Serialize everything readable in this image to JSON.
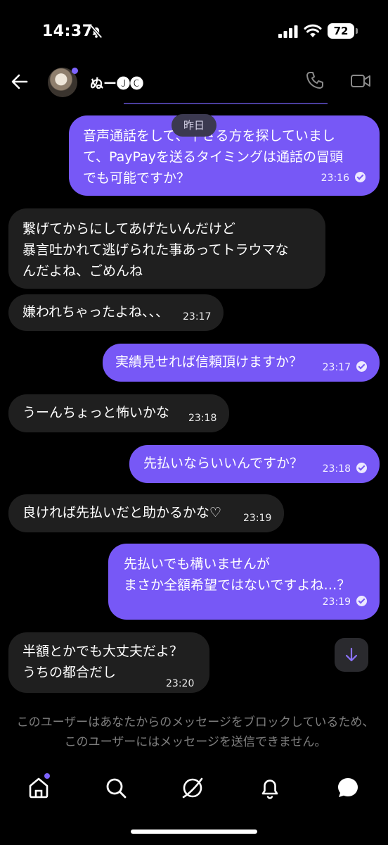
{
  "status_bar": {
    "time": "14:37",
    "battery": "72"
  },
  "header": {
    "contact_name": "ぬー🅙🅒"
  },
  "date_divider": "昨日",
  "messages": [
    {
      "dir": "out",
      "text": "音声通話をして、下さる方を探していまして、PayPayを送るタイミングは通話の冒頭でも可能ですか？",
      "lines": "音声通話をして、下さる方を探していまし\nて、PayPayを送るタイミングは通話の冒頭\nでも可能ですか？",
      "time": "23:16",
      "read": true
    },
    {
      "dir": "in",
      "text": "繋げてからにしてあげたいんだけど暴言吐かれて逃げられた事あってトラウマなんだよね、ごめんね",
      "lines": "繋げてからにしてあげたいんだけど\n暴言吐かれて逃げられた事あってトラウマな\nんだよね、ごめんね",
      "time": ""
    },
    {
      "dir": "in",
      "text": "嫌われちゃったよね、、、",
      "lines": "嫌われちゃったよね、、、",
      "time": "23:17"
    },
    {
      "dir": "out",
      "text": "実績見せれば信頼頂けますか？",
      "lines": "実績見せれば信頼頂けますか？",
      "time": "23:17",
      "read": true
    },
    {
      "dir": "in",
      "text": "うーんちょっと怖いかな",
      "lines": "うーんちょっと怖いかな",
      "time": "23:18"
    },
    {
      "dir": "out",
      "text": "先払いならいいんですか？",
      "lines": "先払いならいいんですか？",
      "time": "23:18",
      "read": true
    },
    {
      "dir": "in",
      "text": "良ければ先払いだと助かるかな♡",
      "lines": "良ければ先払いだと助かるかな♡",
      "time": "23:19"
    },
    {
      "dir": "out",
      "text": "先払いでも構いませんがまさか全額希望ではないですよね…？",
      "lines": "先払いでも構いませんが\nまさか全額希望ではないですよね…？",
      "time": "23:19",
      "read": true
    },
    {
      "dir": "in",
      "text": "半額とかでも大丈夫だよ？うちの都合だし",
      "lines": "半額とかでも大丈夫だよ？\nうちの都合だし",
      "time": "23:20"
    }
  ],
  "blocked_notice": "このユーザーはあなたからのメッセージをブロックしているため、このユーザーにはメッセージを送信できません。",
  "nav": [
    "home-icon",
    "search-icon",
    "explore-icon",
    "bell-icon",
    "messages-icon"
  ],
  "colors": {
    "accent": "#7758f6",
    "incoming": "#1f1f1f",
    "background": "#000000"
  }
}
